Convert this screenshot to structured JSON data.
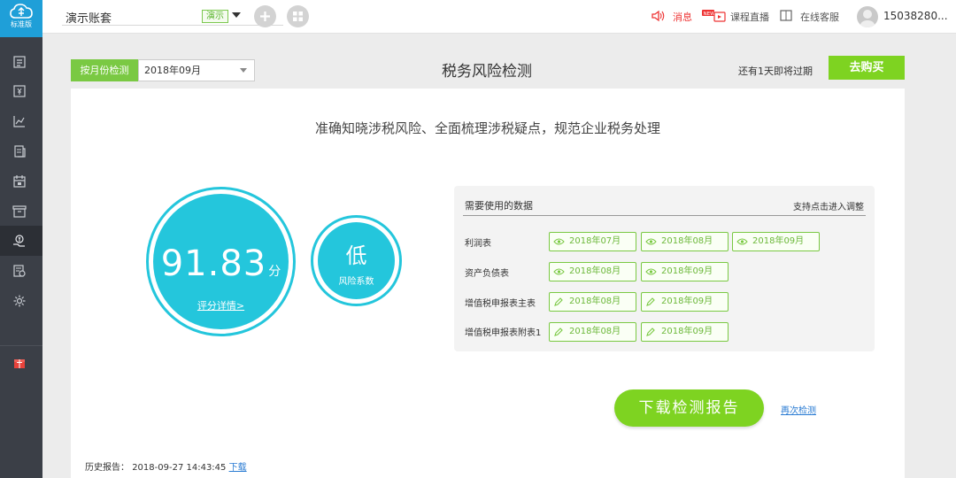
{
  "sidebar": {
    "logo_label": "标准版",
    "items": [
      {
        "icon": "voucher-icon"
      },
      {
        "icon": "yuan-document-icon"
      },
      {
        "icon": "chart-icon"
      },
      {
        "icon": "ledger-icon"
      },
      {
        "icon": "calendar-icon"
      },
      {
        "icon": "archive-icon"
      },
      {
        "icon": "tax-hand-icon"
      },
      {
        "icon": "report-icon"
      },
      {
        "icon": "settings-icon"
      },
      {
        "icon": "gift-icon"
      }
    ]
  },
  "topbar": {
    "account_name": "演示账套",
    "demo_badge": "演示",
    "messages": "消息",
    "live": "课程直播",
    "support": "在线客服",
    "user_id": "15038280..."
  },
  "header": {
    "month_label": "按月份检测",
    "month_value": "2018年09月",
    "title": "税务风险检测",
    "expire_notice": "还有1天即将过期",
    "buy_button": "去购买"
  },
  "main": {
    "tagline": "准确知晓涉税风险、全面梳理涉税疑点，规范企业税务处理",
    "score": {
      "value": "91.83",
      "unit": "分",
      "detail_link": "评分详情>"
    },
    "risk": {
      "level": "低",
      "label": "风险系数"
    },
    "data_panel": {
      "title": "需要使用的数据",
      "hint": "支持点击进入调整",
      "rows": [
        {
          "label": "利润表",
          "chips": [
            {
              "icon": "eye-icon",
              "text": "2018年07月"
            },
            {
              "icon": "eye-icon",
              "text": "2018年08月"
            },
            {
              "icon": "eye-icon",
              "text": "2018年09月"
            }
          ]
        },
        {
          "label": "资产负债表",
          "chips": [
            {
              "icon": "eye-icon",
              "text": "2018年08月"
            },
            {
              "icon": "eye-icon",
              "text": "2018年09月"
            }
          ]
        },
        {
          "label": "增值税申报表主表",
          "chips": [
            {
              "icon": "pencil-icon",
              "text": "2018年08月"
            },
            {
              "icon": "pencil-icon",
              "text": "2018年09月"
            }
          ]
        },
        {
          "label": "增值税申报表附表1",
          "chips": [
            {
              "icon": "pencil-icon",
              "text": "2018年08月"
            },
            {
              "icon": "pencil-icon",
              "text": "2018年09月"
            }
          ]
        }
      ]
    },
    "download_button": "下载检测报告",
    "recheck_link": "再次检测",
    "history_label": "历史报告：",
    "history_time": "2018-09-27 14:43:45",
    "history_download": "下载"
  },
  "colors": {
    "accent_green": "#7ed321",
    "score_cyan": "#24c6dc",
    "sidebar_bg": "#3b3f47",
    "logo_blue": "#1f9fd8",
    "alert_red": "#e33333"
  }
}
